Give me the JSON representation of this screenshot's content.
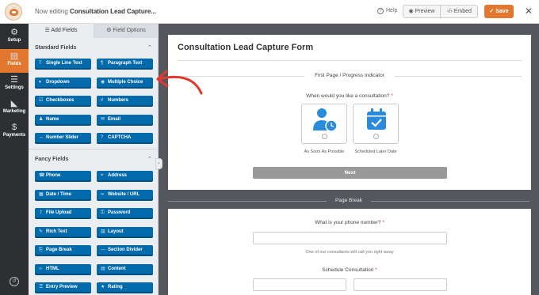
{
  "topbar": {
    "editing_prefix": "Now editing",
    "form_name": "Consultation Lead Capture...",
    "help_label": "Help",
    "preview_label": "Preview",
    "embed_label": "Embed",
    "save_label": "Save",
    "close_glyph": "✕"
  },
  "rail": {
    "items": [
      {
        "label": "Setup",
        "icon": "gear-icon",
        "glyph": "⚙"
      },
      {
        "label": "Fields",
        "icon": "fields-icon",
        "glyph": "▤"
      },
      {
        "label": "Settings",
        "icon": "sliders-icon",
        "glyph": "☰"
      },
      {
        "label": "Marketing",
        "icon": "megaphone-icon",
        "glyph": "📢"
      },
      {
        "label": "Payments",
        "icon": "dollar-icon",
        "glyph": "$"
      }
    ],
    "history_glyph": "↺"
  },
  "panel": {
    "tab_add": "Add Fields",
    "tab_options": "Field Options",
    "standard_heading": "Standard Fields",
    "fancy_heading": "Fancy Fields",
    "standard_fields": [
      {
        "label": "Single Line Text",
        "glyph": "T"
      },
      {
        "label": "Paragraph Text",
        "glyph": "¶"
      },
      {
        "label": "Dropdown",
        "glyph": "▾"
      },
      {
        "label": "Multiple Choice",
        "glyph": "◉"
      },
      {
        "label": "Checkboxes",
        "glyph": "☑"
      },
      {
        "label": "Numbers",
        "glyph": "#"
      },
      {
        "label": "Name",
        "glyph": "♟"
      },
      {
        "label": "Email",
        "glyph": "✉"
      },
      {
        "label": "Number Slider",
        "glyph": "⇔"
      },
      {
        "label": "CAPTCHA",
        "glyph": "?"
      }
    ],
    "fancy_fields": [
      {
        "label": "Phone",
        "glyph": "☎"
      },
      {
        "label": "Address",
        "glyph": "⌖"
      },
      {
        "label": "Date / Time",
        "glyph": "▦"
      },
      {
        "label": "Website / URL",
        "glyph": "∞"
      },
      {
        "label": "File Upload",
        "glyph": "⇪"
      },
      {
        "label": "Password",
        "glyph": "⚿"
      },
      {
        "label": "Rich Text",
        "glyph": "✎"
      },
      {
        "label": "Layout",
        "glyph": "▥"
      },
      {
        "label": "Page Break",
        "glyph": "⎘"
      },
      {
        "label": "Section Divider",
        "glyph": "—"
      },
      {
        "label": "HTML",
        "glyph": "‹›"
      },
      {
        "label": "Content",
        "glyph": "▤"
      },
      {
        "label": "Entry Preview",
        "glyph": "☰"
      },
      {
        "label": "Rating",
        "glyph": "★"
      }
    ]
  },
  "form": {
    "title": "Consultation Lead Capture Form",
    "page_indicator": "First Page / Progress Indicator",
    "question_consult": "When would you like a consultation?",
    "required_mark": "*",
    "choices": [
      {
        "label": "As Soon As Possible",
        "icon": "user-clock-icon"
      },
      {
        "label": "Scheduled Later Date",
        "icon": "calendar-check-icon"
      }
    ],
    "next_label": "Next",
    "page_break_label": "Page Break",
    "question_phone": "What is your phone number?",
    "phone_description": "One of our consultants will call you right away",
    "question_schedule": "Schedule Consultation"
  },
  "colors": {
    "accent": "#e27730",
    "field_button": "#036aab",
    "rail": "#2d2f32",
    "canvas": "#54585d",
    "annotation": "#e03a2f",
    "icon_blue": "#2a8bdc"
  }
}
